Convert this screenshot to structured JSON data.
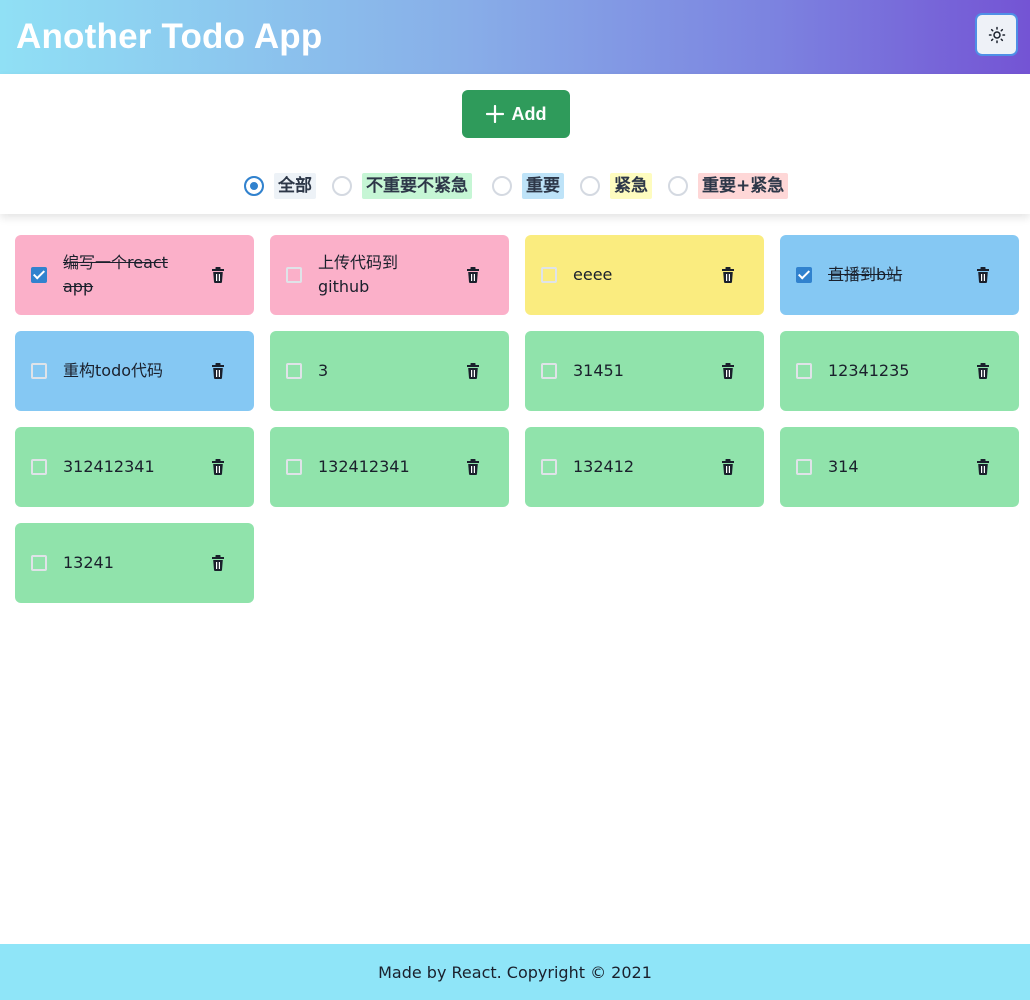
{
  "header": {
    "title": "Another Todo App",
    "theme_icon": "sun-icon"
  },
  "toolbar": {
    "add_label": "Add",
    "filters": [
      {
        "label": "全部",
        "checked": true,
        "bg": "#edf2f7"
      },
      {
        "label": "不重要不紧急",
        "checked": false,
        "bg": "#c6f6d5"
      },
      {
        "label": "重要",
        "checked": false,
        "bg": "#bee3f8"
      },
      {
        "label": "紧急",
        "checked": false,
        "bg": "#fefcbf"
      },
      {
        "label": "重要+紧急",
        "checked": false,
        "bg": "#fed7d7"
      }
    ]
  },
  "todos": [
    {
      "text": "编写一个react app",
      "done": true,
      "color": "#fbb0c9"
    },
    {
      "text": "上传代码到github",
      "done": false,
      "color": "#fbb0c9"
    },
    {
      "text": "eeee",
      "done": false,
      "color": "#faec7f"
    },
    {
      "text": "直播到b站",
      "done": true,
      "color": "#85c8f3"
    },
    {
      "text": "重构todo代码",
      "done": false,
      "color": "#85c8f3"
    },
    {
      "text": "3",
      "done": false,
      "color": "#90e3ab"
    },
    {
      "text": "31451",
      "done": false,
      "color": "#90e3ab"
    },
    {
      "text": "12341235",
      "done": false,
      "color": "#90e3ab"
    },
    {
      "text": "312412341",
      "done": false,
      "color": "#90e3ab"
    },
    {
      "text": "132412341",
      "done": false,
      "color": "#90e3ab"
    },
    {
      "text": "132412",
      "done": false,
      "color": "#90e3ab"
    },
    {
      "text": "314",
      "done": false,
      "color": "#90e3ab"
    },
    {
      "text": "13241",
      "done": false,
      "color": "#90e3ab"
    }
  ],
  "footer": {
    "text": "Made by React. Copyright © 2021"
  }
}
